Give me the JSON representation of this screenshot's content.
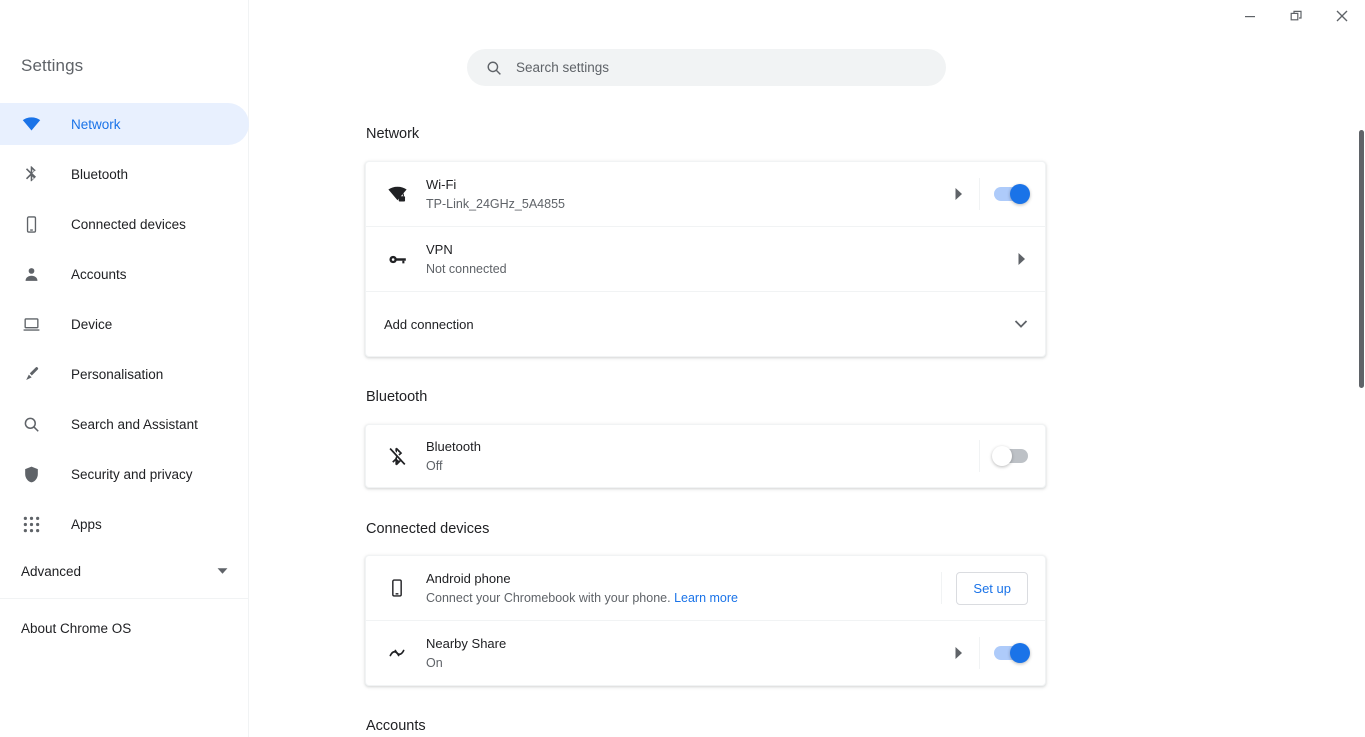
{
  "window": {
    "minimize_icon": "minimize-icon",
    "restore_icon": "restore-icon",
    "close_icon": "close-icon"
  },
  "sidebar": {
    "title": "Settings",
    "items": [
      {
        "label": "Network",
        "icon": "wifi-icon",
        "selected": true
      },
      {
        "label": "Bluetooth",
        "icon": "bluetooth-icon",
        "selected": false
      },
      {
        "label": "Connected devices",
        "icon": "phone-icon",
        "selected": false
      },
      {
        "label": "Accounts",
        "icon": "person-icon",
        "selected": false
      },
      {
        "label": "Device",
        "icon": "laptop-icon",
        "selected": false
      },
      {
        "label": "Personalisation",
        "icon": "brush-icon",
        "selected": false
      },
      {
        "label": "Search and Assistant",
        "icon": "search-icon",
        "selected": false
      },
      {
        "label": "Security and privacy",
        "icon": "shield-icon",
        "selected": false
      },
      {
        "label": "Apps",
        "icon": "apps-grid-icon",
        "selected": false
      }
    ],
    "advanced": {
      "label": "Advanced",
      "icon": "triangle-down-icon"
    },
    "about": {
      "label": "About Chrome OS"
    }
  },
  "search": {
    "placeholder": "Search settings",
    "value": "",
    "icon": "search-icon"
  },
  "sections": [
    {
      "title": "Network",
      "rows": [
        {
          "icon": "wifi-locked-icon",
          "title": "Wi-Fi",
          "subtitle": "TP-Link_24GHz_5A4855",
          "arrow": "chevron-right-icon",
          "toggle": "on"
        },
        {
          "icon": "vpn-key-icon",
          "title": "VPN",
          "subtitle": "Not connected",
          "arrow": "chevron-right-icon",
          "toggle": null
        }
      ],
      "footer": {
        "label": "Add connection",
        "icon": "chevron-down-icon"
      }
    },
    {
      "title": "Bluetooth",
      "rows": [
        {
          "icon": "bluetooth-disabled-icon",
          "title": "Bluetooth",
          "subtitle": "Off",
          "arrow": null,
          "toggle": "off"
        }
      ]
    },
    {
      "title": "Connected devices",
      "rows": [
        {
          "icon": "phone-icon",
          "title": "Android phone",
          "subtitle": "Connect your Chromebook with your phone.",
          "link": "Learn more",
          "button": "Set up"
        },
        {
          "icon": "nearby-share-icon",
          "title": "Nearby Share",
          "subtitle": "On",
          "arrow": "chevron-right-icon",
          "toggle": "on"
        }
      ]
    },
    {
      "title": "Accounts",
      "rows": []
    }
  ],
  "colors": {
    "accent": "#1a73e8",
    "selected_bg": "#e8f0fe",
    "toggle_on_track": "#aecbfa",
    "toggle_off_track": "#bdc1c6",
    "text_primary": "#202124",
    "text_secondary": "#5f6368"
  }
}
